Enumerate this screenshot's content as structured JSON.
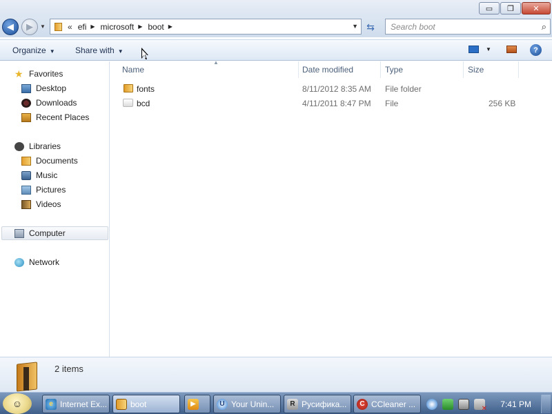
{
  "window": {
    "minimize_glyph": "▭",
    "maximize_glyph": "❐",
    "close_glyph": "✕"
  },
  "address": {
    "chevron": "«",
    "crumbs": [
      "efi",
      "microsoft",
      "boot"
    ],
    "search_placeholder": "Search boot"
  },
  "toolbar": {
    "organize_label": "Organize",
    "share_label": "Share with"
  },
  "sidebar": {
    "favorites": {
      "label": "Favorites",
      "items": [
        "Desktop",
        "Downloads",
        "Recent Places"
      ]
    },
    "libraries": {
      "label": "Libraries",
      "items": [
        "Documents",
        "Music",
        "Pictures",
        "Videos"
      ]
    },
    "computer": {
      "label": "Computer",
      "selected": true
    },
    "network": {
      "label": "Network"
    }
  },
  "filelist": {
    "columns": [
      "Name",
      "Date modified",
      "Type",
      "Size"
    ],
    "rows": [
      {
        "name": "fonts",
        "date": "8/11/2012 8:35 AM",
        "type": "File folder",
        "size": "",
        "icon": "folder-icon"
      },
      {
        "name": "bcd",
        "date": "4/11/2011 8:47 PM",
        "type": "File",
        "size": "256 KB",
        "icon": "file-icon"
      }
    ]
  },
  "details": {
    "items_count": "2 items"
  },
  "taskbar": {
    "tasks": [
      {
        "label": "Internet Ex...",
        "icon": "internet-explorer-icon"
      },
      {
        "label": "boot",
        "icon": "folder-icon",
        "active": true
      },
      {
        "label": "",
        "icon": "media-player-icon"
      },
      {
        "label": "Your Unin...",
        "icon": "your-uninstaller-icon"
      },
      {
        "label": "Русифика...",
        "icon": "russifier-icon"
      },
      {
        "label": "CCleaner ...",
        "icon": "ccleaner-icon"
      }
    ],
    "clock": "7:41 PM"
  }
}
